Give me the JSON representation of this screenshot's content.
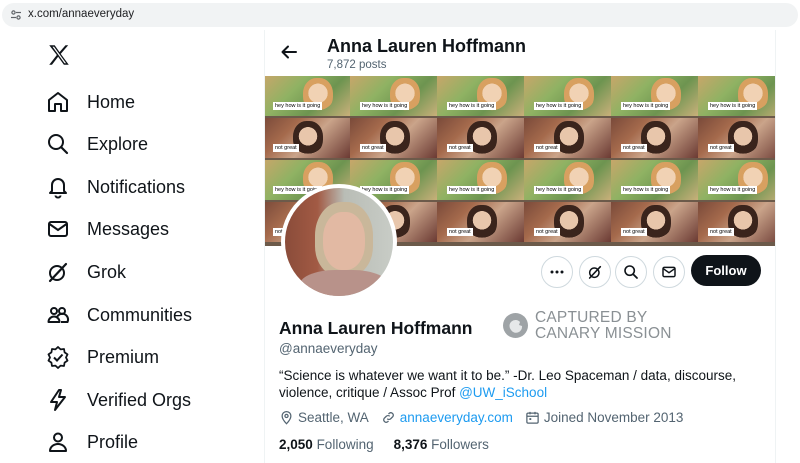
{
  "browser": {
    "url": "x.com/annaeveryday"
  },
  "sidebar": {
    "logo": "x-logo-icon",
    "items": [
      {
        "label": "Home",
        "icon": "home-icon"
      },
      {
        "label": "Explore",
        "icon": "search-icon"
      },
      {
        "label": "Notifications",
        "icon": "bell-icon"
      },
      {
        "label": "Messages",
        "icon": "envelope-icon"
      },
      {
        "label": "Grok",
        "icon": "grok-icon"
      },
      {
        "label": "Communities",
        "icon": "people-icon"
      },
      {
        "label": "Premium",
        "icon": "verified-badge-icon"
      },
      {
        "label": "Verified Orgs",
        "icon": "lightning-icon"
      },
      {
        "label": "Profile",
        "icon": "person-icon"
      }
    ]
  },
  "header": {
    "name": "Anna Lauren Hoffmann",
    "posts": "7,872 posts"
  },
  "banner": {
    "caption_top": "hey how is it going",
    "caption_bottom": "not great"
  },
  "profile": {
    "name": "Anna Lauren Hoffmann",
    "handle": "@annaeveryday",
    "bio_text": "“Science is whatever we want it to be.” -Dr. Leo Spaceman / data, discourse, violence, critique / Assoc Prof ",
    "bio_link": "@UW_iSchool",
    "location": "Seattle, WA",
    "website": "annaeveryday.com",
    "joined": "Joined November 2013",
    "following_count": "2,050",
    "following_label": "Following",
    "followers_count": "8,376",
    "followers_label": "Followers"
  },
  "actions": {
    "follow_label": "Follow"
  },
  "watermark": {
    "line1": "CAPTURED BY",
    "line2": "CANARY MISSION"
  },
  "colors": {
    "accent": "#1d9bf0",
    "text": "#0f1419",
    "muted": "#536471",
    "follow_bg": "#0f1419"
  }
}
